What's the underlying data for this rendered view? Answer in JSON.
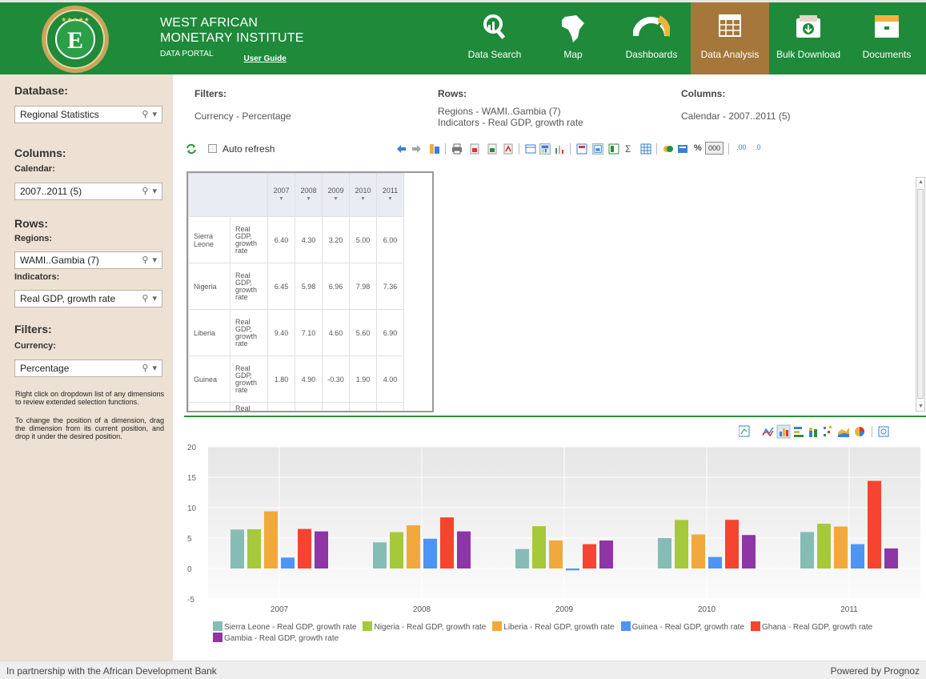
{
  "header": {
    "brand_line1": "WEST AFRICAN",
    "brand_line2": "MONETARY INSTITUTE",
    "brand_line3": "DATA PORTAL",
    "user_guide": "User Guide",
    "logo_letter": "E",
    "nav": [
      {
        "label": "Data Search",
        "icon": "search-icon"
      },
      {
        "label": "Map",
        "icon": "africa-map-icon"
      },
      {
        "label": "Dashboards",
        "icon": "gauge-icon"
      },
      {
        "label": "Data Analysis",
        "icon": "table-icon",
        "active": true
      },
      {
        "label": "Bulk Download",
        "icon": "download-icon"
      },
      {
        "label": "Documents",
        "icon": "folder-icon"
      }
    ],
    "colors": {
      "bar": "#1e8a3a",
      "active": "#a5773a"
    }
  },
  "sidebar": {
    "database_heading": "Database:",
    "database_value": "Regional Statistics",
    "columns_heading": "Columns:",
    "calendar_label": "Calendar:",
    "calendar_value": "2007..2011 (5)",
    "rows_heading": "Rows:",
    "regions_label": "Regions:",
    "regions_value": "WAMI..Gambia (7)",
    "indicators_label": "Indicators:",
    "indicators_value": "Real GDP, growth rate",
    "filters_heading": "Filters:",
    "currency_label": "Currency:",
    "currency_value": "Percentage",
    "note1": "Right click on dropdown list of any dimensions to review extended selection functions.",
    "note2": "To change the position of a dimension, drag the dimension from its current position, and drop it under the desired position."
  },
  "filters_bar": {
    "filters_title": "Filters:",
    "filters_value": "Currency - Percentage",
    "rows_title": "Rows:",
    "rows_value1": "Regions - WAMI..Gambia (7)",
    "rows_value2": "Indicators - Real GDP, growth rate",
    "columns_title": "Columns:",
    "columns_value": "Calendar - 2007..2011 (5)"
  },
  "toolbar": {
    "auto_refresh": "Auto refresh",
    "percent": "%",
    "thousands": "000",
    "sigma": "Σ",
    "dec_up": ".00",
    "dec_down": ".0"
  },
  "grid": {
    "years": [
      "2007",
      "2008",
      "2009",
      "2010",
      "2011"
    ],
    "rows": [
      {
        "region": "Sierra Leone",
        "indicator": "Real GDP, growth rate",
        "values": [
          "6.40",
          "4.30",
          "3.20",
          "5.00",
          "6.00"
        ]
      },
      {
        "region": "Nigeria",
        "indicator": "Real GDP, growth rate",
        "values": [
          "6.45",
          "5.98",
          "6.96",
          "7.98",
          "7.36"
        ]
      },
      {
        "region": "Liberia",
        "indicator": "Real GDP, growth rate",
        "values": [
          "9.40",
          "7.10",
          "4.60",
          "5.60",
          "6.90"
        ]
      },
      {
        "region": "Guinea",
        "indicator": "Real GDP, growth rate",
        "values": [
          "1.80",
          "4.90",
          "-0.30",
          "1.90",
          "4.00"
        ]
      },
      {
        "region": "",
        "indicator": "Real",
        "values": [
          "",
          "",
          "",
          "",
          ""
        ]
      }
    ]
  },
  "chart_data": {
    "type": "bar",
    "categories": [
      "2007",
      "2008",
      "2009",
      "2010",
      "2011"
    ],
    "ylim": [
      -5,
      20
    ],
    "yticks": [
      "20",
      "15",
      "10",
      "5",
      "0",
      "-5"
    ],
    "series": [
      {
        "name": "Sierra Leone - Real GDP, growth rate",
        "color": "#86bcb6",
        "values": [
          6.4,
          4.3,
          3.2,
          5.0,
          6.0
        ]
      },
      {
        "name": "Nigeria - Real GDP, growth rate",
        "color": "#a5c93b",
        "values": [
          6.45,
          5.98,
          6.96,
          7.98,
          7.36
        ]
      },
      {
        "name": "Liberia - Real GDP, growth rate",
        "color": "#f2a93b",
        "values": [
          9.4,
          7.1,
          4.6,
          5.6,
          6.9
        ]
      },
      {
        "name": "Guinea - Real GDP, growth rate",
        "color": "#4d95f5",
        "values": [
          1.8,
          4.9,
          -0.3,
          1.9,
          4.0
        ]
      },
      {
        "name": "Ghana - Real GDP, growth rate",
        "color": "#f5442f",
        "values": [
          6.5,
          8.4,
          4.0,
          8.0,
          14.4
        ]
      },
      {
        "name": "Gambia - Real GDP, growth rate",
        "color": "#8e36a5",
        "values": [
          6.1,
          6.1,
          4.6,
          5.5,
          3.3
        ]
      }
    ],
    "grid": true,
    "legend": "bottom"
  },
  "footer": {
    "left": "In partnership with the African Development Bank",
    "right": "Powered by Prognoz"
  }
}
